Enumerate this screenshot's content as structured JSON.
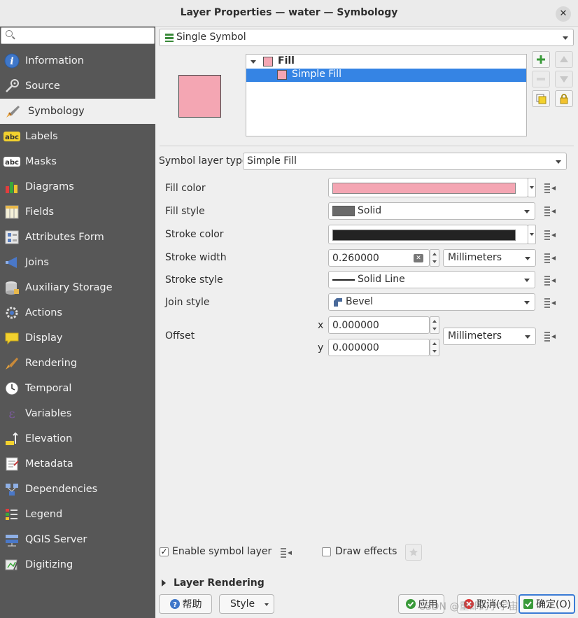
{
  "window": {
    "title": "Layer Properties — water — Symbology",
    "close_glyph": "✕"
  },
  "sidebar": {
    "search": {
      "value": "",
      "placeholder": ""
    },
    "items": [
      {
        "label": "Information",
        "icon": "information-icon"
      },
      {
        "label": "Source",
        "icon": "source-icon"
      },
      {
        "label": "Symbology",
        "icon": "symbology-brush-icon",
        "active": true
      },
      {
        "label": "Labels",
        "icon": "labels-abc-icon"
      },
      {
        "label": "Masks",
        "icon": "masks-abc-icon"
      },
      {
        "label": "Diagrams",
        "icon": "diagrams-icon"
      },
      {
        "label": "Fields",
        "icon": "fields-icon"
      },
      {
        "label": "Attributes Form",
        "icon": "attributes-form-icon"
      },
      {
        "label": "Joins",
        "icon": "joins-icon"
      },
      {
        "label": "Auxiliary Storage",
        "icon": "auxiliary-storage-icon"
      },
      {
        "label": "Actions",
        "icon": "actions-gear-icon"
      },
      {
        "label": "Display",
        "icon": "display-bubble-icon"
      },
      {
        "label": "Rendering",
        "icon": "rendering-brush-icon"
      },
      {
        "label": "Temporal",
        "icon": "temporal-clock-icon"
      },
      {
        "label": "Variables",
        "icon": "variables-epsilon-icon"
      },
      {
        "label": "Elevation",
        "icon": "elevation-icon"
      },
      {
        "label": "Metadata",
        "icon": "metadata-icon"
      },
      {
        "label": "Dependencies",
        "icon": "dependencies-icon"
      },
      {
        "label": "Legend",
        "icon": "legend-icon"
      },
      {
        "label": "QGIS Server",
        "icon": "qgis-server-icon"
      },
      {
        "label": "Digitizing",
        "icon": "digitizing-icon"
      }
    ]
  },
  "symbology": {
    "renderer": "Single Symbol",
    "tree": {
      "root": "Fill",
      "child": "Simple Fill"
    },
    "symbol_layer_type_label": "Symbol layer type",
    "symbol_layer_type": "Simple Fill"
  },
  "properties": {
    "fill_color_label": "Fill color",
    "fill_color": "#f4a6b3",
    "fill_style_label": "Fill style",
    "fill_style": "Solid",
    "stroke_color_label": "Stroke color",
    "stroke_color": "#232323",
    "stroke_width_label": "Stroke width",
    "stroke_width": "0.260000",
    "stroke_width_unit": "Millimeters",
    "stroke_style_label": "Stroke style",
    "stroke_style": "Solid Line",
    "join_style_label": "Join style",
    "join_style": "Bevel",
    "offset_label": "Offset",
    "offset_x_label": "x",
    "offset_x": "0.000000",
    "offset_y_label": "y",
    "offset_y": "0.000000",
    "offset_unit": "Millimeters"
  },
  "footer": {
    "enable_symbol_layer": "Enable symbol layer",
    "enable_symbol_layer_checked": true,
    "draw_effects": "Draw effects",
    "draw_effects_checked": false,
    "layer_rendering": "Layer Rendering",
    "help": "帮助",
    "style": "Style",
    "apply": "应用",
    "cancel": "取消(C)",
    "ok": "确定(O)",
    "watermark": "CSDN @重邮的小宇宙"
  }
}
